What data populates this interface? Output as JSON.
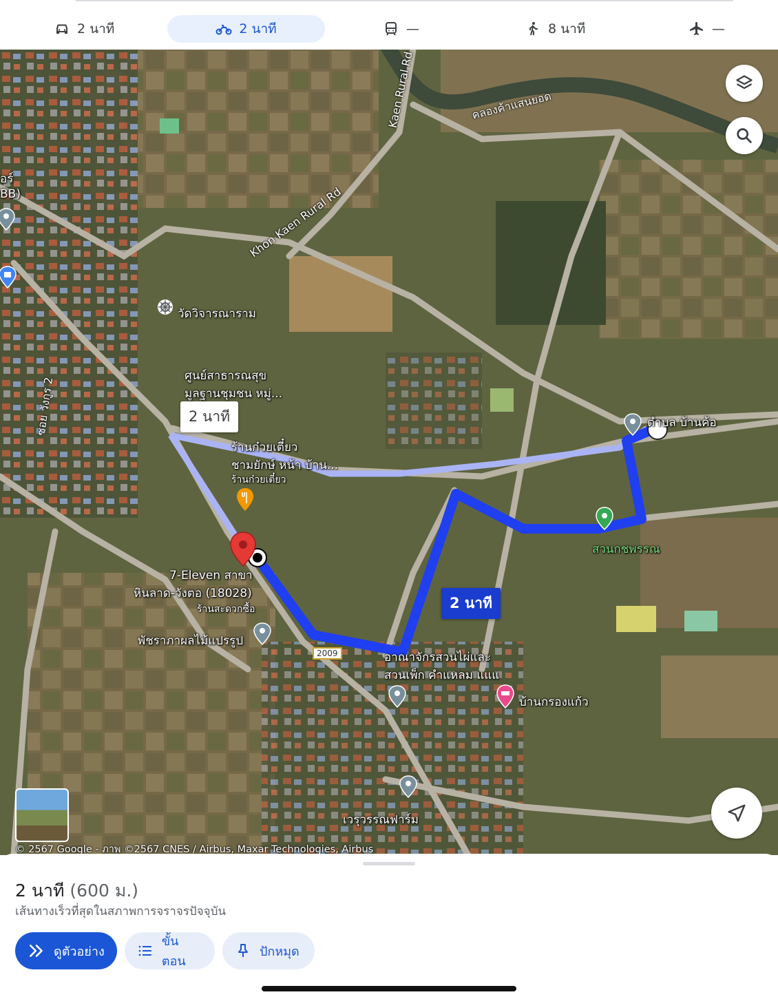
{
  "modes": [
    {
      "icon": "car-icon",
      "label": "2 นาที",
      "active": false
    },
    {
      "icon": "motorcycle-icon",
      "label": "2 นาที",
      "active": true
    },
    {
      "icon": "transit-icon",
      "label": "—",
      "active": false
    },
    {
      "icon": "walk-icon",
      "label": "8 นาที",
      "active": false
    },
    {
      "icon": "flight-icon",
      "label": "—",
      "active": false
    }
  ],
  "map": {
    "place_labels": {
      "temple": "วัดวิจารณาราม",
      "health_center_1": "ศูนย์สาธารณสุข",
      "health_center_2": "มูลฐานชุมชน หมู่...",
      "noodle_1": "ร้านก๋วยเตี๋ยว",
      "noodle_2": "ชามยักษ์ หน้า บ้าน...",
      "noodle_sub": "ร้านก๋วยเตี๋ยว",
      "seven_1": "7-Eleven สาขา",
      "seven_2": "หินลาด-วังตอ (18028)",
      "seven_sub": "ร้านสะดวกซื้อ",
      "fruit": "พัชราภาผลไม้แปรรูป",
      "bamboo_1": "อาณาจักรสวนไผ่และ",
      "bamboo_2": "สวนเพ็ก คำแหลม แแแ",
      "krongkaew": "บ้านกรองแก้ว",
      "farm": "เวรุวรรณฟาร์ม",
      "park": "สวนกชพรรณ",
      "dest_1": "ตำบล บ้านค้อ",
      "left_edge_1": "อร์",
      "left_edge_2": "BB)"
    },
    "road_labels": {
      "rural_top": "Kaen Rural Rd",
      "rural_mid": "Khon Kaen Rural Rd",
      "canal": "คลองค้าแสนยอด",
      "soi": "ซอย วังกูร 2"
    },
    "shield": "2009",
    "bubbles": {
      "alt_route": "2 นาที",
      "main_route": "2 นาที"
    },
    "copyright": "© 2567 Google - ภาพ ©2567 CNES / Airbus, Maxar Technologies, Airbus",
    "colors": {
      "route": "#1f3ff0",
      "alt_route": "#aab4f5",
      "pin": "#e53935"
    }
  },
  "sheet": {
    "duration": "2 นาที",
    "distance": "(600 ม.)",
    "subtitle": "เส้นทางเร็วที่สุดในสภาพการจราจรปัจจุบัน",
    "buttons": {
      "preview": "ดูตัวอย่าง",
      "steps": "ขั้นตอน",
      "pin": "ปักหมุด"
    }
  }
}
